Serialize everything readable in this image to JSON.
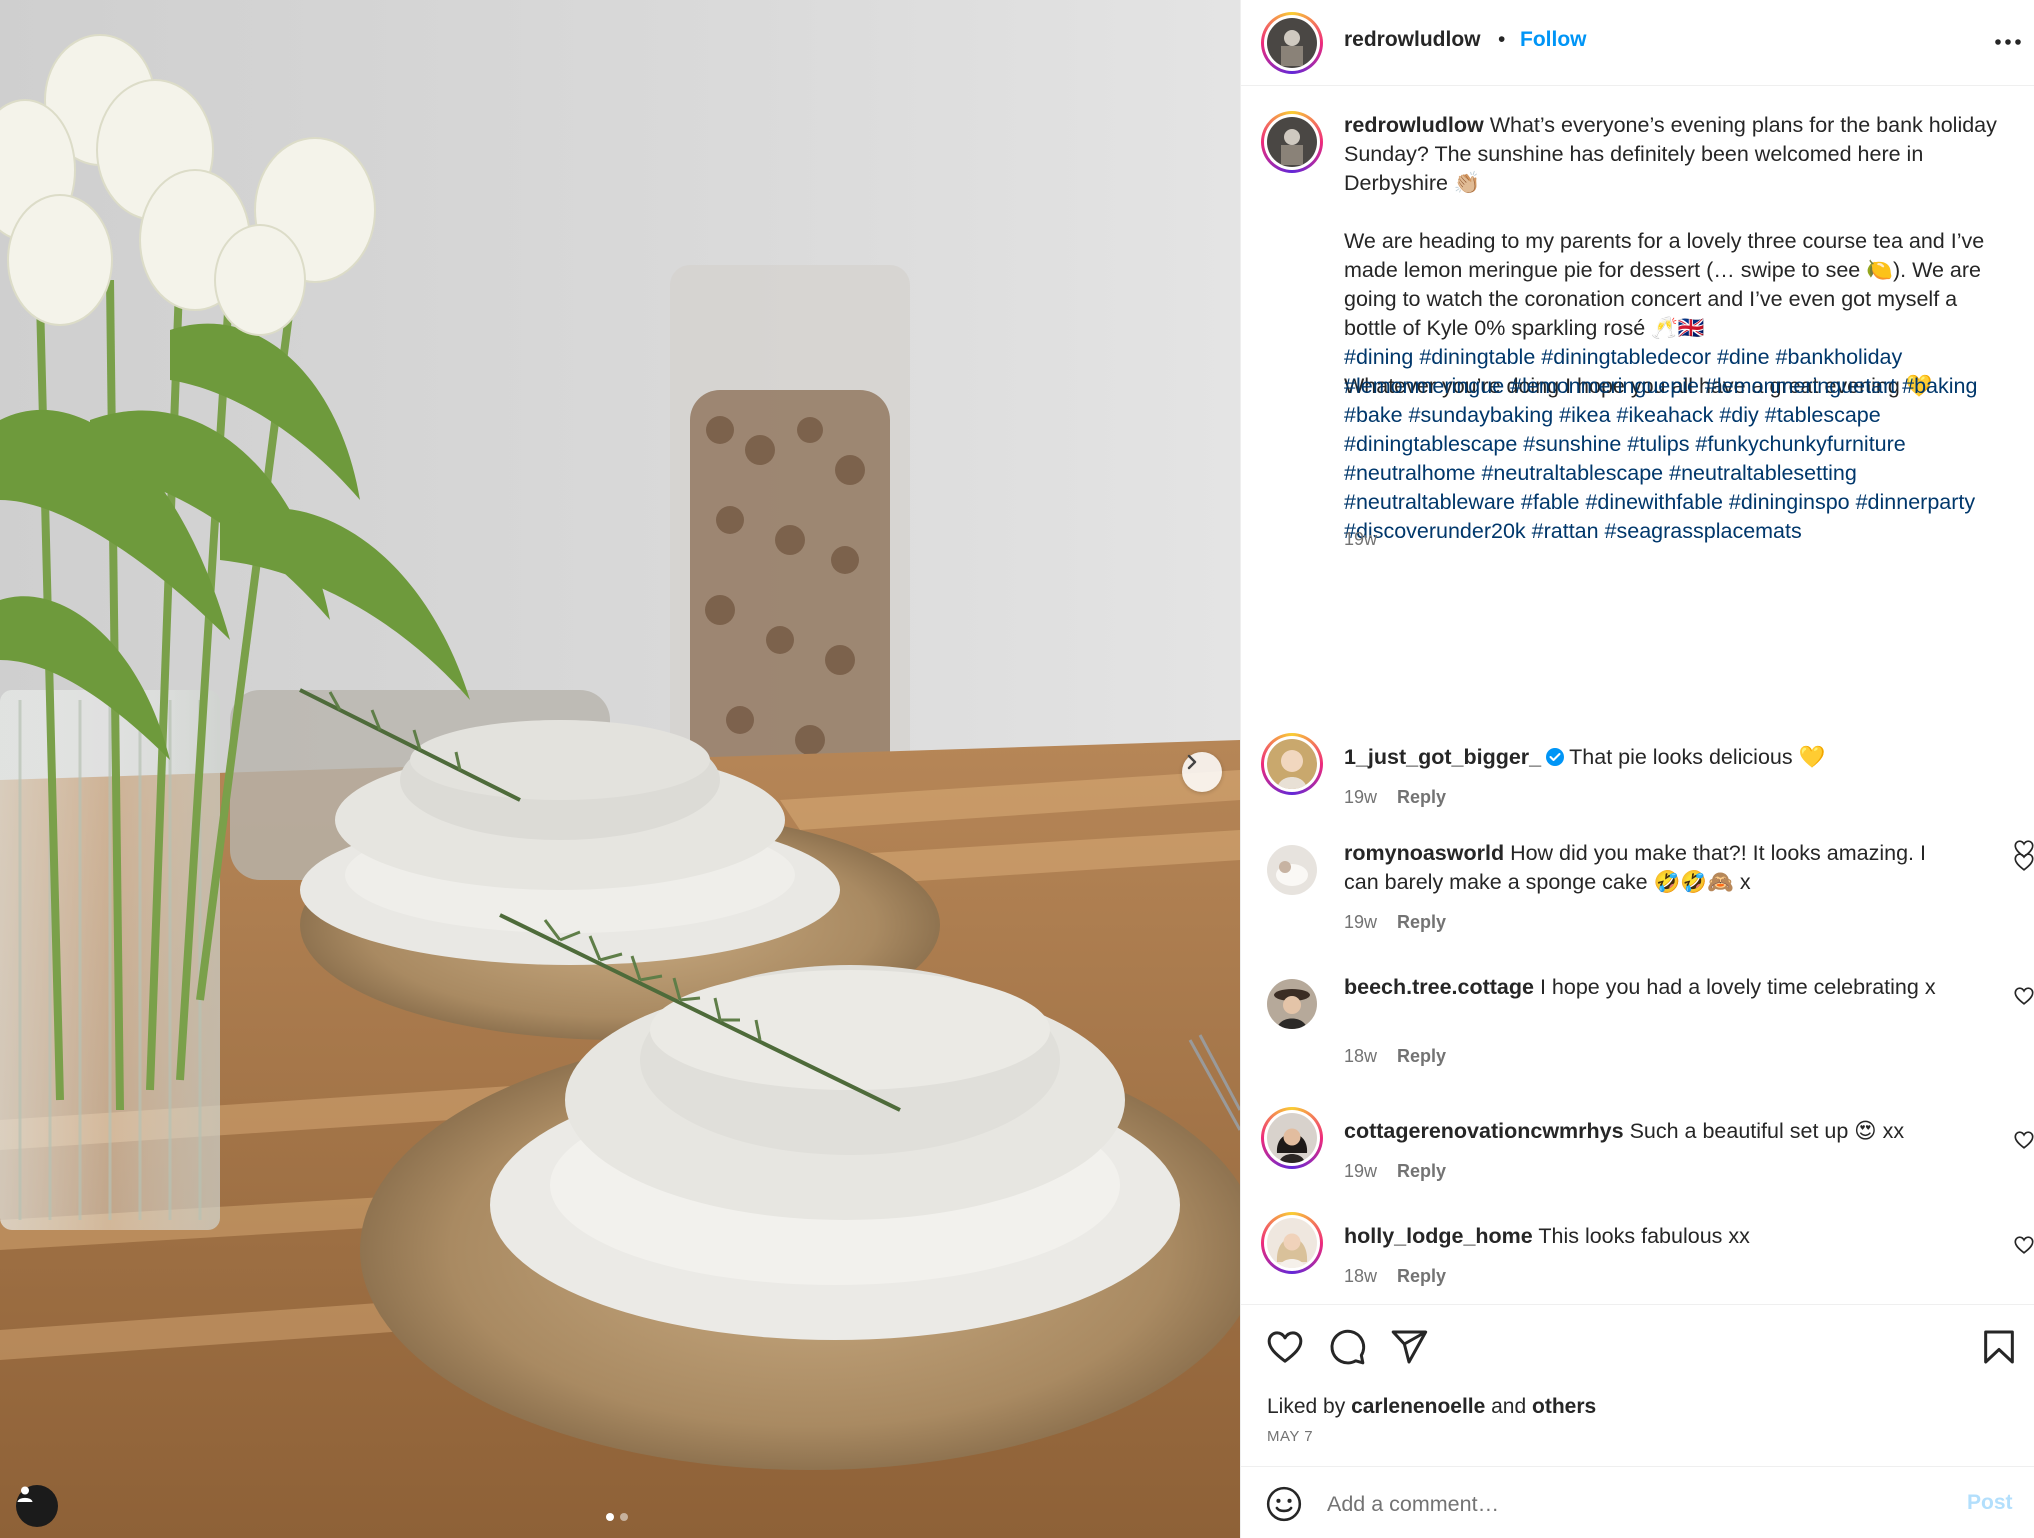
{
  "header": {
    "username": "redrowludlow",
    "separator": "•",
    "follow_label": "Follow",
    "more_icon": "more-horizontal-icon"
  },
  "caption": {
    "username": "redrowludlow",
    "text": " What’s everyone’s evening plans for the bank holiday Sunday? The sunshine has definitely been welcomed here in Derbyshire 👏🏼\n\nWe are heading to my parents for a lovely three course tea and I’ve made lemon meringue pie for dessert (… swipe to see 🍋). We are going to watch the coronation concert and I’ve even got myself a bottle of Kyle 0% sparkling rosé 🥂🇬🇧\n\nWhatever you’re doing I hope you all have a great evening 💛",
    "hashtags": "#dining #diningtable #diningtabledecor #dine #bankholiday #lemonmeringue #lemonmeringuepie #lemonmeringuetart #baking #bake #sundaybaking #ikea #ikeahack #diy #tablescape #diningtablescape #sunshine #tulips #funkychunkyfurniture #neutralhome #neutraltablescape #neutraltablesetting #neutraltableware #fable #dinewithfable #dininginspo #dinnerparty #discoverunder20k #rattan #seagrassplacemats",
    "timestamp": "19w"
  },
  "comments": [
    {
      "username": "1_just_got_bigger_",
      "text": "That pie looks delicious 💛",
      "time": "19w",
      "reply": "Reply",
      "verified": true
    },
    {
      "username": "romynoasworld",
      "text": "How did you make that?! It looks amazing. I can barely make a sponge cake 🤣🤣🙈 x",
      "time": "19w",
      "reply": "Reply"
    },
    {
      "username": "beech.tree.cottage",
      "text": "I hope you had a lovely time celebrating x",
      "time": "18w",
      "reply": "Reply"
    },
    {
      "username": "cottagerenovationcwmrhys",
      "text": "Such a beautiful set up 😍 xx",
      "time": "19w",
      "reply": "Reply"
    },
    {
      "username": "holly_lodge_home",
      "text": "This looks fabulous xx",
      "time": "18w",
      "reply": "Reply"
    }
  ],
  "actions": {
    "liked_prefix": "Liked by ",
    "liked_user": "carlenenoelle",
    "liked_and": " and ",
    "liked_others": "others",
    "date": "MAY 7",
    "icons": [
      "heart-icon",
      "comment-icon",
      "share-icon",
      "bookmark-icon"
    ]
  },
  "comment_box": {
    "placeholder": "Add a comment…",
    "post_label": "Post"
  },
  "carousel": {
    "total_slides": 2,
    "current_slide": 1
  },
  "colors": {
    "follow": "#0095f6",
    "hashtag": "#00376b",
    "secondary": "#737373",
    "post_disabled": "#b3dffc",
    "verified": "#0095f6"
  }
}
